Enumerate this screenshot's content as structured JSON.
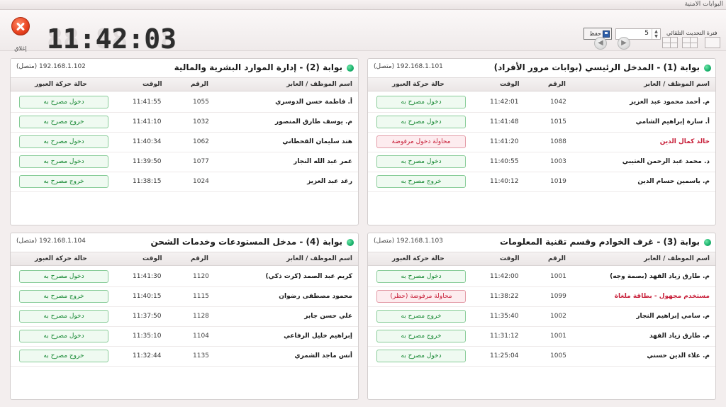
{
  "window": {
    "title": "البوابات الامنية"
  },
  "toolbar": {
    "close_label": "إغلاق",
    "clock": "11:42:03",
    "refresh_label": "فترة التحديث التلقائي",
    "refresh_value": "5",
    "save_label": "حفظ"
  },
  "columns": {
    "name": "اسم الموظف / العابر",
    "num": "الرقم",
    "time": "الوقت",
    "status": "حالة حركة العبور"
  },
  "gates": [
    {
      "title": "بوابة (1) - المدخل الرئيسي (بوابات مرور الأفراد)",
      "ip": "192.168.1.101 (متصل)",
      "rows": [
        {
          "name": "م. أحمد محمود عبد العزيز",
          "num": "1042",
          "time": "11:42:01",
          "status": "دخول مصرح به",
          "state": "ok"
        },
        {
          "name": "أ. سارة إبراهيم الشامي",
          "num": "1015",
          "time": "11:41:48",
          "status": "دخول مصرح به",
          "state": "ok"
        },
        {
          "name": "خالد كمال الدين",
          "num": "1088",
          "time": "11:41:20",
          "status": "محاولة دخول مرفوضة",
          "state": "bad"
        },
        {
          "name": "د. محمد عبد الرحمن العتيبي",
          "num": "1003",
          "time": "11:40:55",
          "status": "دخول مصرح به",
          "state": "ok"
        },
        {
          "name": "م. ياسمين حسام الدين",
          "num": "1019",
          "time": "11:40:12",
          "status": "خروج مصرح به",
          "state": "ok"
        }
      ]
    },
    {
      "title": "بوابة (2) - إدارة الموارد البشرية والمالية",
      "ip": "192.168.1.102 (متصل)",
      "rows": [
        {
          "name": "أ. فاطمة حسن الدوسري",
          "num": "1055",
          "time": "11:41:55",
          "status": "دخول مصرح به",
          "state": "ok"
        },
        {
          "name": "م. يوسف طارق المنصور",
          "num": "1032",
          "time": "11:41:10",
          "status": "خروج مصرح به",
          "state": "ok"
        },
        {
          "name": "هند سليمان القحطاني",
          "num": "1062",
          "time": "11:40:34",
          "status": "دخول مصرح به",
          "state": "ok"
        },
        {
          "name": "عمر عبد الله النجار",
          "num": "1077",
          "time": "11:39:50",
          "status": "دخول مصرح به",
          "state": "ok"
        },
        {
          "name": "رغد عبد العزيز",
          "num": "1024",
          "time": "11:38:15",
          "status": "خروج مصرح به",
          "state": "ok"
        }
      ]
    },
    {
      "title": "بوابة (3) - غرف الخوادم وقسم تقنية المعلومات",
      "ip": "192.168.1.103 (متصل)",
      "rows": [
        {
          "name": "م. طارق زياد الفهد (بصمة وجه)",
          "num": "1001",
          "time": "11:42:00",
          "status": "دخول مصرح به",
          "state": "ok"
        },
        {
          "name": "مستخدم مجهول - بطاقة ملغاة",
          "num": "1099",
          "time": "11:38:22",
          "status": "محاولة مرفوضة (حظر)",
          "state": "bad"
        },
        {
          "name": "م. سامي إبراهيم النجار",
          "num": "1002",
          "time": "11:35:40",
          "status": "خروج مصرح به",
          "state": "ok"
        },
        {
          "name": "م. طارق زياد الفهد",
          "num": "1001",
          "time": "11:31:12",
          "status": "خروج مصرح به",
          "state": "ok"
        },
        {
          "name": "م. علاء الدين حسني",
          "num": "1005",
          "time": "11:25:04",
          "status": "دخول مصرح به",
          "state": "ok"
        }
      ]
    },
    {
      "title": "بوابة (4) - مدخل المستودعات وخدمات الشحن",
      "ip": "192.168.1.104 (متصل)",
      "rows": [
        {
          "name": "كريم عبد الصمد (كرت ذكي)",
          "num": "1120",
          "time": "11:41:30",
          "status": "دخول مصرح به",
          "state": "ok"
        },
        {
          "name": "محمود مصطفى رضوان",
          "num": "1115",
          "time": "11:40:15",
          "status": "خروج مصرح به",
          "state": "ok"
        },
        {
          "name": "علي حسن جابر",
          "num": "1128",
          "time": "11:37:50",
          "status": "دخول مصرح به",
          "state": "ok"
        },
        {
          "name": "إبراهيم خليل الرفاعي",
          "num": "1104",
          "time": "11:35:10",
          "status": "دخول مصرح به",
          "state": "ok"
        },
        {
          "name": "أنس ماجد الشمري",
          "num": "1135",
          "time": "11:32:44",
          "status": "خروج مصرح به",
          "state": "ok"
        }
      ]
    }
  ]
}
